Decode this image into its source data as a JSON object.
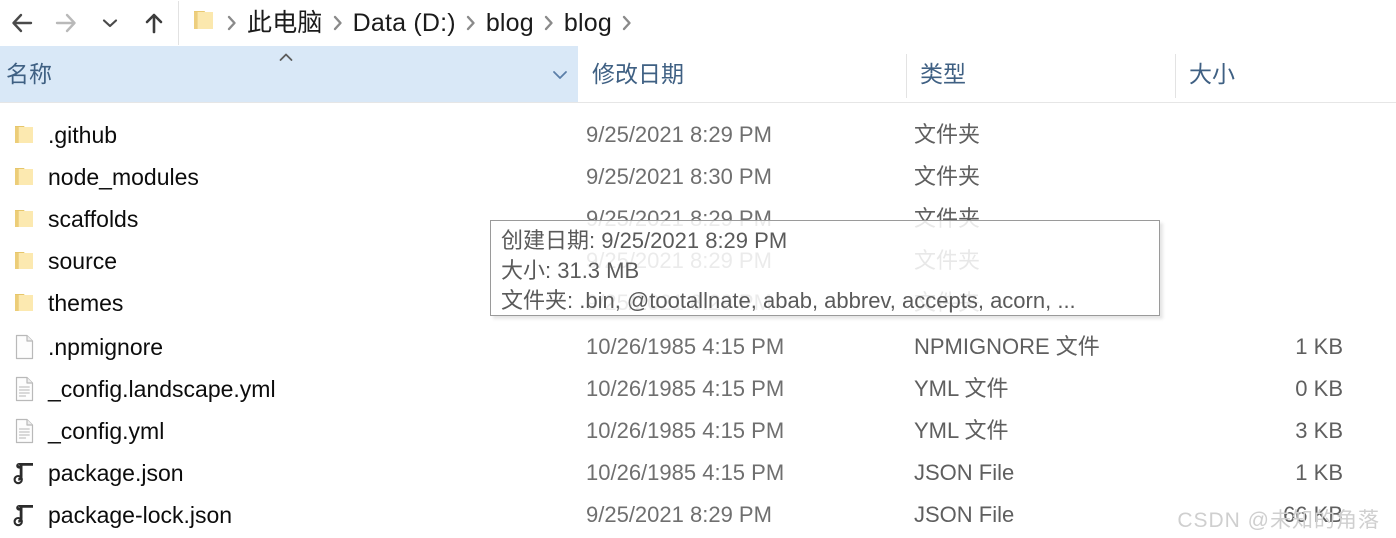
{
  "nav": {
    "back_icon": "arrow-left-icon",
    "forward_icon": "arrow-right-icon",
    "history_icon": "chevron-down-icon",
    "up_icon": "arrow-up-icon",
    "folder_icon": "folder-icon",
    "breadcrumb": [
      "此电脑",
      "Data (D:)",
      "blog",
      "blog"
    ]
  },
  "columns": [
    {
      "label": "名称",
      "sorted": true,
      "sort_direction": "asc"
    },
    {
      "label": "修改日期",
      "sorted": false
    },
    {
      "label": "类型",
      "sorted": false
    },
    {
      "label": "大小",
      "sorted": false
    }
  ],
  "rows": [
    {
      "name": ".github",
      "date": "9/25/2021 8:29 PM",
      "type": "文件夹",
      "size": "",
      "icon": "folder-icon"
    },
    {
      "name": "node_modules",
      "date": "9/25/2021 8:30 PM",
      "type": "文件夹",
      "size": "",
      "icon": "folder-icon"
    },
    {
      "name": "scaffolds",
      "date": "9/25/2021 8:29 PM",
      "type": "文件夹",
      "size": "",
      "icon": "folder-icon"
    },
    {
      "name": "source",
      "date": "9/25/2021 8:29 PM",
      "type": "文件夹",
      "size": "",
      "icon": "folder-icon"
    },
    {
      "name": "themes",
      "date": "9/25/2021 8:29 PM",
      "type": "文件夹",
      "size": "",
      "icon": "folder-icon"
    },
    {
      "name": ".npmignore",
      "date": "10/26/1985 4:15 PM",
      "type": "NPMIGNORE 文件",
      "size": "1 KB",
      "icon": "blank-file-icon"
    },
    {
      "name": "_config.landscape.yml",
      "date": "10/26/1985 4:15 PM",
      "type": "YML 文件",
      "size": "0 KB",
      "icon": "text-file-icon"
    },
    {
      "name": "_config.yml",
      "date": "10/26/1985 4:15 PM",
      "type": "YML 文件",
      "size": "3 KB",
      "icon": "text-file-icon"
    },
    {
      "name": "package.json",
      "date": "10/26/1985 4:15 PM",
      "type": "JSON File",
      "size": "1 KB",
      "icon": "json-file-icon"
    },
    {
      "name": "package-lock.json",
      "date": "9/25/2021 8:29 PM",
      "type": "JSON File",
      "size": "66 KB",
      "icon": "json-file-icon"
    }
  ],
  "tooltip": {
    "created_line": "创建日期: 9/25/2021 8:29 PM",
    "size_line": "大小: 31.3 MB",
    "folders_line": "文件夹: .bin, @tootallnate, abab, abbrev, accepts, acorn, ..."
  },
  "watermark": {
    "text": "CSDN @未知的角落"
  },
  "colors": {
    "sorted_header_bg": "#d9e8f7",
    "header_text": "#3f6083",
    "row_name_text": "#0c0c0c",
    "row_meta_text": "#6f6f6f",
    "folder_icon": "#f5d88a",
    "tooltip_border": "#9a9a9a",
    "watermark": "#cfcfcf"
  }
}
